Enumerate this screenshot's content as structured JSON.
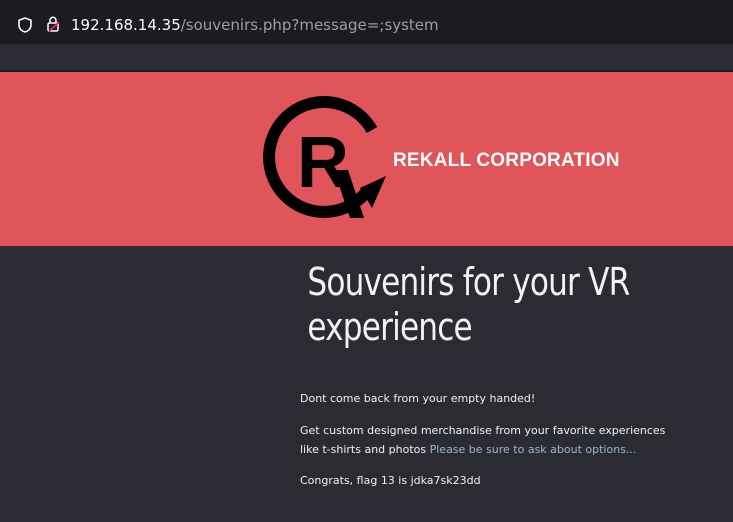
{
  "browser": {
    "url_host": "192.168.14.35",
    "url_path": "/souvenirs.php?message=;system",
    "icons": [
      "shield-icon",
      "lock-warning-icon"
    ]
  },
  "header": {
    "logo_letter": "R",
    "brand_name": "REKALL CORPORATION",
    "colors": {
      "banner": "#e0555a",
      "logo": "#000000",
      "brand_text": "#ffffff"
    }
  },
  "main": {
    "title_line1": "Souvenirs for your VR",
    "title_line2": "experience",
    "paragraph1": "Dont come back from your empty handed!",
    "paragraph2_text": "Get custom designed merchandise from your favorite experiences like t-shirts and photos",
    "paragraph2_link": "Please be sure to ask about options...",
    "paragraph3": "Congrats, flag 13 is jdka7sk23dd",
    "colors": {
      "background": "#2b2c33",
      "text": "#f0f0f0",
      "link": "#9fb3d6"
    }
  }
}
